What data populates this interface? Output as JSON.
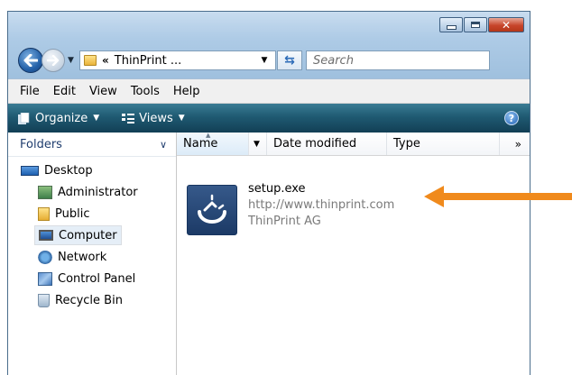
{
  "address": {
    "chevron": "«",
    "path": "ThinPrint ..."
  },
  "search": {
    "placeholder": "Search"
  },
  "menubar": {
    "items": [
      "File",
      "Edit",
      "View",
      "Tools",
      "Help"
    ]
  },
  "commandbar": {
    "organize": "Organize",
    "views": "Views",
    "help": "?"
  },
  "navpane": {
    "header": "Folders",
    "tree": [
      {
        "label": "Desktop",
        "icon": "desktop-icon"
      },
      {
        "label": "Administrator",
        "icon": "user-folder-icon"
      },
      {
        "label": "Public",
        "icon": "folder-icon"
      },
      {
        "label": "Computer",
        "icon": "computer-icon",
        "selected": true
      },
      {
        "label": "Network",
        "icon": "network-icon"
      },
      {
        "label": "Control Panel",
        "icon": "control-panel-icon"
      },
      {
        "label": "Recycle Bin",
        "icon": "recycle-bin-icon"
      }
    ]
  },
  "columns": {
    "name": "Name",
    "date": "Date modified",
    "type": "Type",
    "more": "»"
  },
  "file": {
    "name": "setup.exe",
    "url": "http://www.thinprint.com",
    "company": "ThinPrint AG"
  },
  "colors": {
    "accent": "#f08a1c",
    "commandbar": "#1f5a72"
  }
}
